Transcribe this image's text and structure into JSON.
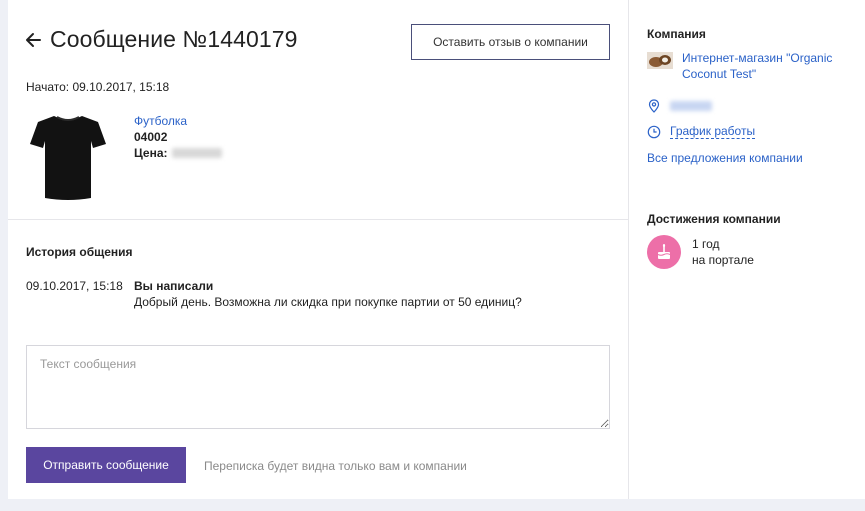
{
  "header": {
    "title": "Сообщение №1440179",
    "review_button": "Оставить отзыв о компании"
  },
  "started": "Начато: 09.10.2017, 15:18",
  "product": {
    "name": "Футболка",
    "code": "04002",
    "price_label": "Цена:"
  },
  "history": {
    "title": "История общения",
    "messages": [
      {
        "time": "09.10.2017, 15:18",
        "author": "Вы написали",
        "text": "Добрый день. Возможна ли скидка при покупке партии от 50 единиц?"
      }
    ]
  },
  "composer": {
    "placeholder": "Текст сообщения",
    "send_button": "Отправить сообщение",
    "note": "Переписка будет видна только вам и компании"
  },
  "sidebar": {
    "company_title": "Компания",
    "company_name": "Интернет-магазин \"Organic Coconut Test\"",
    "schedule_link": "График работы",
    "offers_link": "Все предложения компании",
    "achievements_title": "Достижения компании",
    "achievement_years": "1 год",
    "achievement_caption": "на портале"
  },
  "colors": {
    "accent": "#5a469f",
    "link": "#2b62c8",
    "badge": "#ed6fa8"
  },
  "icons": {
    "back": "arrow-left-icon",
    "location": "location-pin-icon",
    "clock": "clock-icon",
    "achievement": "cake-icon"
  }
}
